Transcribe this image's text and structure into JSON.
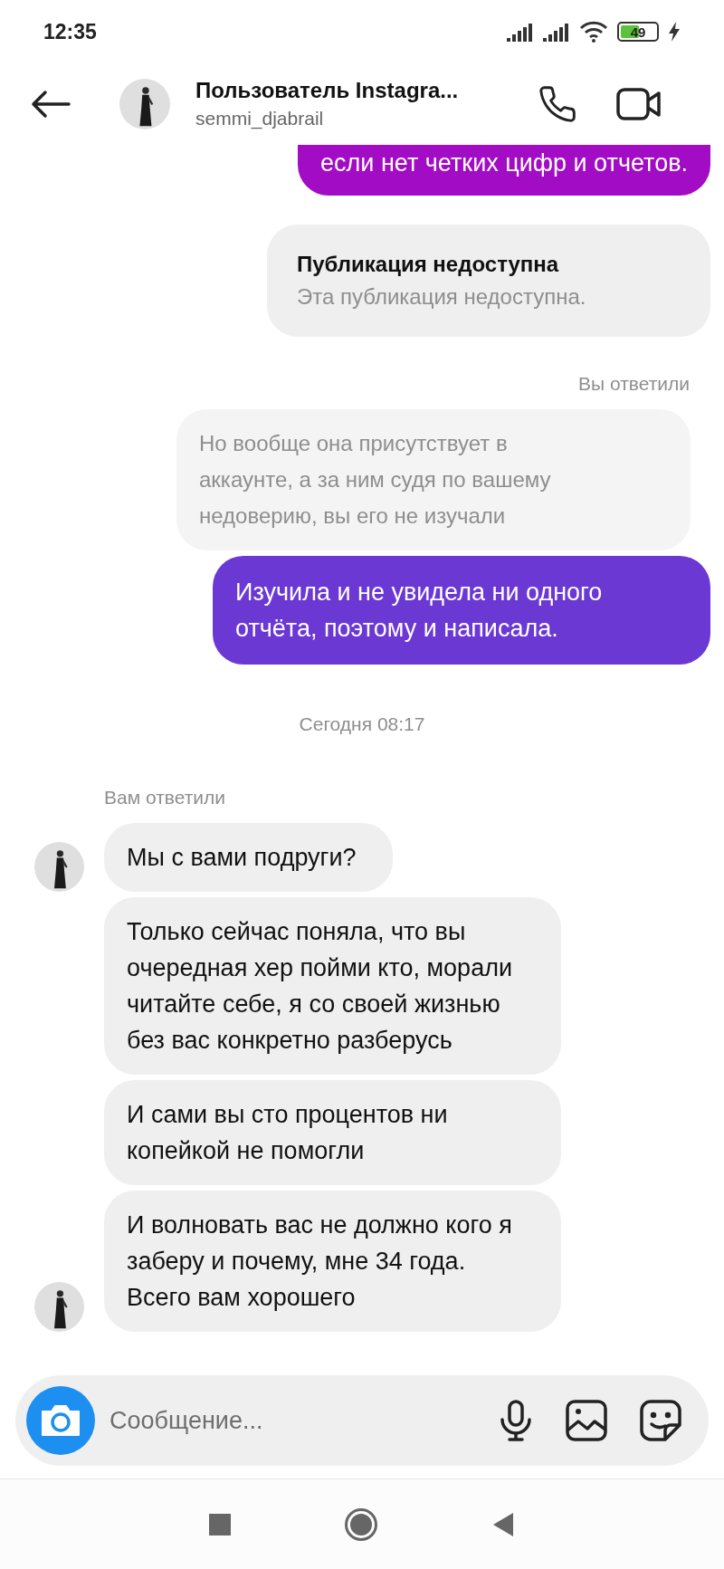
{
  "status_bar": {
    "time": "12:35",
    "battery": "49"
  },
  "header": {
    "title": "Пользователь Instagra...",
    "username": "semmi_djabrail"
  },
  "messages": [
    {
      "kind": "text",
      "outgoing": true,
      "text": "если нет четких цифр и отчетов.",
      "color": "#a20cc4",
      "clipped": true
    },
    {
      "kind": "unavailable",
      "title": "Публикация недоступна",
      "text": "Эта публикация недоступна."
    },
    {
      "kind": "sentlabel",
      "text": "Вы ответили"
    },
    {
      "kind": "quote",
      "text": "Но вообще она присутствует в аккаунте, а за ним судя по вашему недоверию, вы его не изучали"
    },
    {
      "kind": "text",
      "outgoing": true,
      "text": "Изучила и не увидела ни одного отчёта, поэтому и написала.",
      "color": "#6b38d4",
      "clipped": false
    },
    {
      "kind": "timestamp",
      "text": "Сегодня 08:17"
    },
    {
      "kind": "receivedlabel",
      "text": "Вам ответили"
    },
    {
      "kind": "text",
      "outgoing": false,
      "text": "Мы с вами подруги?",
      "avatar": true
    },
    {
      "kind": "text",
      "outgoing": false,
      "text": "Только сейчас поняла, что вы очередная хер пойми кто, морали читайте себе, я со своей жизнью без вас конкретно разберусь",
      "avatar": false
    },
    {
      "kind": "text",
      "outgoing": false,
      "text": "И сами вы сто процентов ни копейкой не помогли",
      "avatar": false
    },
    {
      "kind": "text",
      "outgoing": false,
      "text": "И волновать вас не должно кого я заберу и почему, мне 34 года. Всего вам хорошего",
      "avatar": true
    }
  ],
  "composer": {
    "placeholder": "Сообщение..."
  }
}
